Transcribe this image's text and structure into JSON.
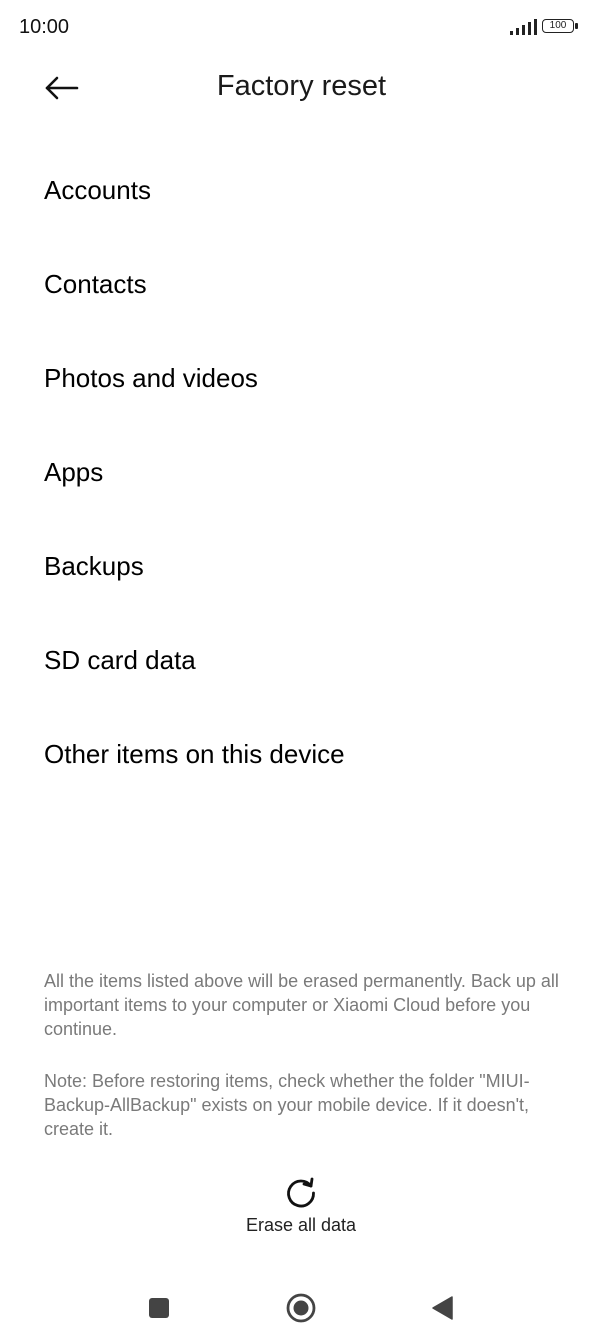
{
  "status_bar": {
    "time": "10:00",
    "battery": "100",
    "icons": [
      "signal-icon",
      "battery-icon"
    ]
  },
  "header": {
    "back_icon": "arrow-left-icon",
    "title": "Factory reset"
  },
  "items": [
    {
      "label": "Accounts"
    },
    {
      "label": "Contacts"
    },
    {
      "label": "Photos and videos"
    },
    {
      "label": "Apps"
    },
    {
      "label": "Backups"
    },
    {
      "label": "SD card data"
    },
    {
      "label": "Other items on this device"
    }
  ],
  "notes": {
    "warning": "All the items listed above will be erased permanently. Back up all important items to your computer or Xiaomi Cloud before you continue.",
    "restore": "Note: Before restoring items, check whether the folder \"MIUI-Backup-AllBackup\" exists on your mobile device. If it doesn't, create it."
  },
  "erase": {
    "icon": "refresh-icon",
    "label": "Erase all data"
  },
  "nav_bar": {
    "icons": [
      "recents-square-icon",
      "home-circle-icon",
      "back-triangle-icon"
    ]
  },
  "colors": {
    "background": "#ffffff",
    "text_primary": "#000000",
    "text_secondary": "#7a7a7a"
  }
}
